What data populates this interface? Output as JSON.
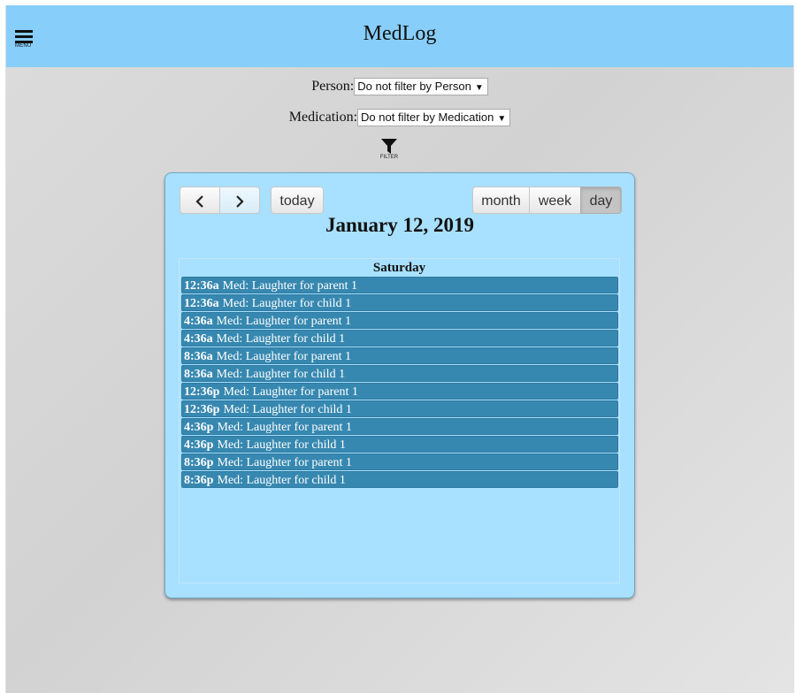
{
  "app": {
    "title": "MedLog",
    "menu_label": "MENU"
  },
  "filters": {
    "person_label": "Person:",
    "person_value": "Do not filter by Person",
    "medication_label": "Medication:",
    "medication_value": "Do not filter by Medication",
    "filter_button_label": "FILTER"
  },
  "calendar": {
    "today_label": "today",
    "view_buttons": {
      "month": "month",
      "week": "week",
      "day": "day"
    },
    "active_view": "day",
    "title": "January 12, 2019",
    "day_header": "Saturday",
    "event_color": "#3788b0",
    "events": [
      {
        "time": "12:36a",
        "title": "Med: Laughter for parent 1"
      },
      {
        "time": "12:36a",
        "title": "Med: Laughter for child 1"
      },
      {
        "time": "4:36a",
        "title": "Med: Laughter for parent 1"
      },
      {
        "time": "4:36a",
        "title": "Med: Laughter for child 1"
      },
      {
        "time": "8:36a",
        "title": "Med: Laughter for parent 1"
      },
      {
        "time": "8:36a",
        "title": "Med: Laughter for child 1"
      },
      {
        "time": "12:36p",
        "title": "Med: Laughter for parent 1"
      },
      {
        "time": "12:36p",
        "title": "Med: Laughter for child 1"
      },
      {
        "time": "4:36p",
        "title": "Med: Laughter for parent 1"
      },
      {
        "time": "4:36p",
        "title": "Med: Laughter for child 1"
      },
      {
        "time": "8:36p",
        "title": "Med: Laughter for parent 1"
      },
      {
        "time": "8:36p",
        "title": "Med: Laughter for child 1"
      }
    ]
  },
  "colors": {
    "topbar": "#87cefa",
    "calendar_bg": "#a8e0ff"
  }
}
